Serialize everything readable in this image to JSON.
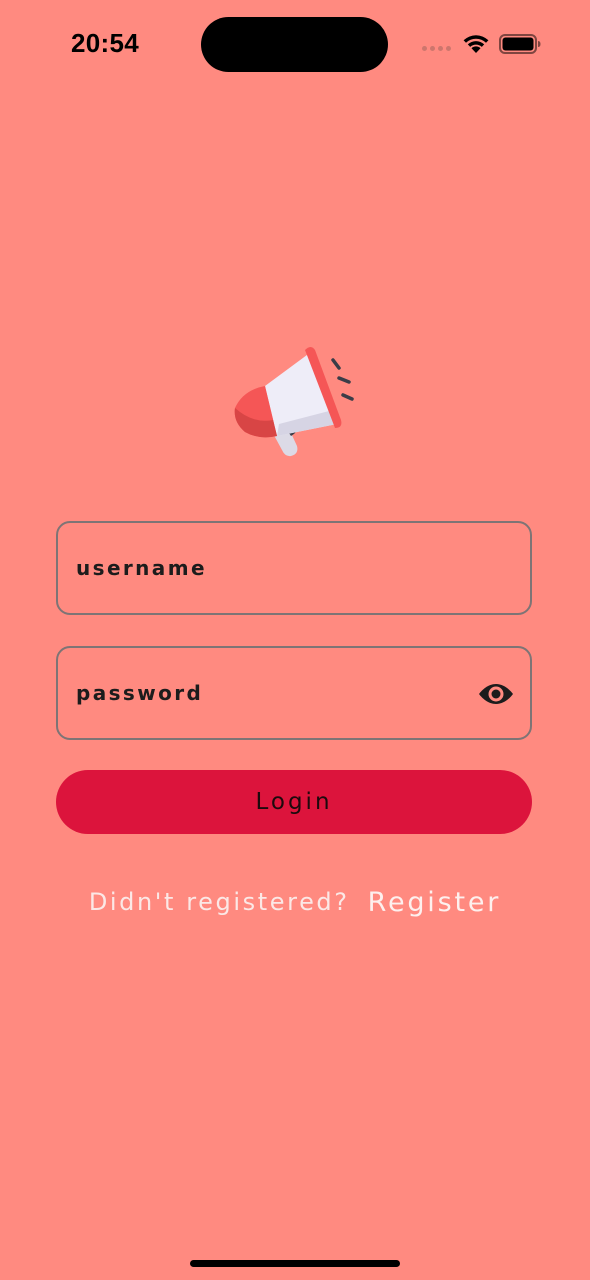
{
  "status_bar": {
    "time": "20:54"
  },
  "logo": {
    "icon": "megaphone-icon"
  },
  "login_form": {
    "username_placeholder": "username",
    "password_placeholder": "password",
    "password_toggle_icon": "eye-icon",
    "login_label": "Login"
  },
  "register": {
    "prompt": "Didn't registered?",
    "link_label": "Register"
  },
  "colors": {
    "background": "#FF8A80",
    "login_button": "#DC143C"
  }
}
